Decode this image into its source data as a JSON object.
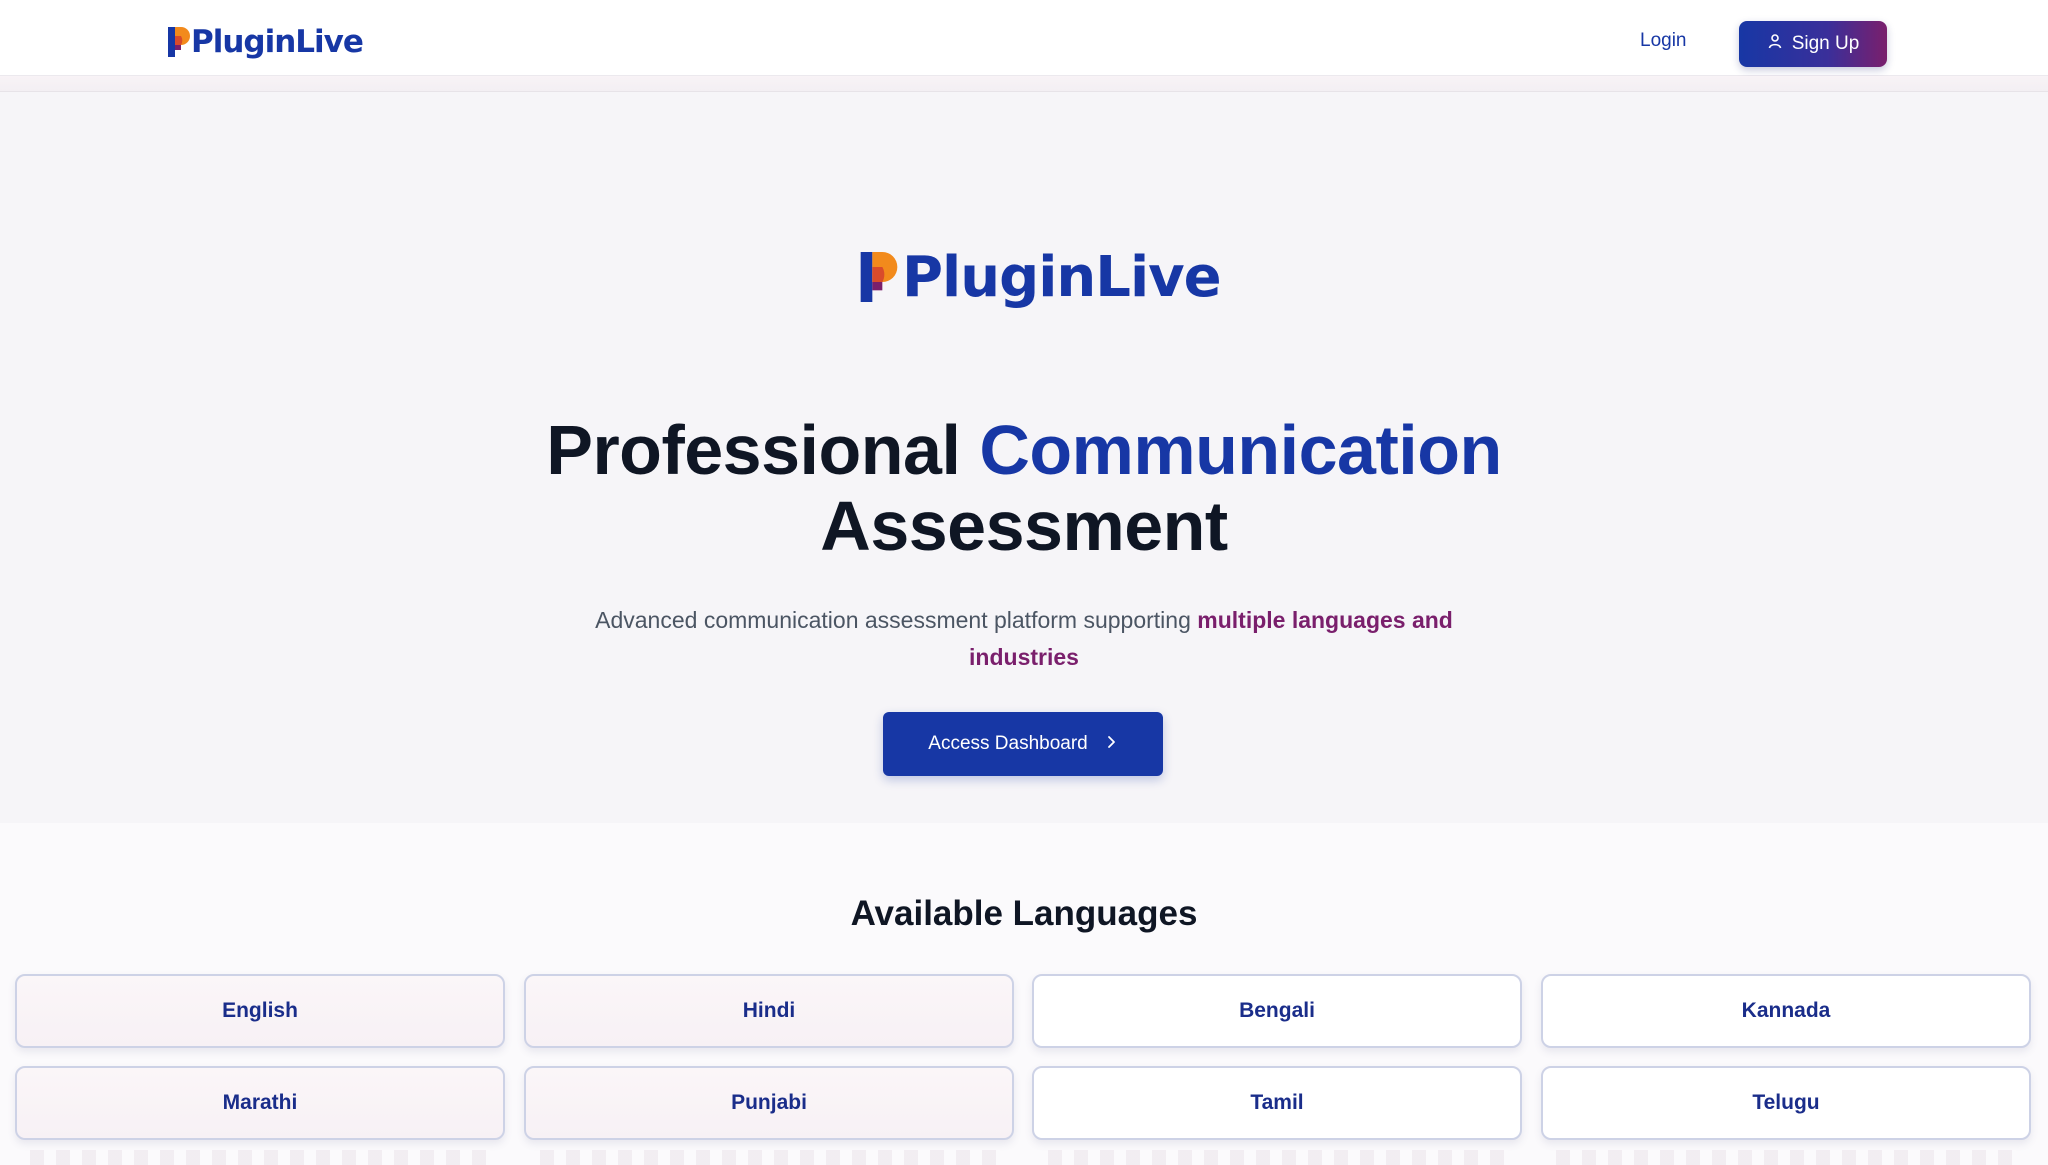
{
  "header": {
    "logo_text": "PluginLive",
    "login_label": "Login",
    "signup_label": "Sign Up"
  },
  "hero": {
    "logo_text": "PluginLive",
    "title_part1": "Professional",
    "title_accent": "Communication",
    "title_part2": "Assessment",
    "subtitle_text": "Advanced communication assessment platform supporting",
    "subtitle_accent": "multiple languages and industries",
    "cta_label": "Access Dashboard"
  },
  "languages": {
    "title": "Available Languages",
    "items": [
      {
        "label": "English"
      },
      {
        "label": "Hindi"
      },
      {
        "label": "Bengali"
      },
      {
        "label": "Kannada"
      },
      {
        "label": "Marathi"
      },
      {
        "label": "Punjabi"
      },
      {
        "label": "Tamil"
      },
      {
        "label": "Telugu"
      }
    ]
  },
  "colors": {
    "brand_blue": "#1737a5",
    "brand_magenta": "#7a1f6c",
    "logo_orange": "#f28a1c"
  },
  "icons": {
    "signup": "user-icon",
    "cta": "chevron-right-icon",
    "logo_mark": "logo-mark-icon"
  }
}
